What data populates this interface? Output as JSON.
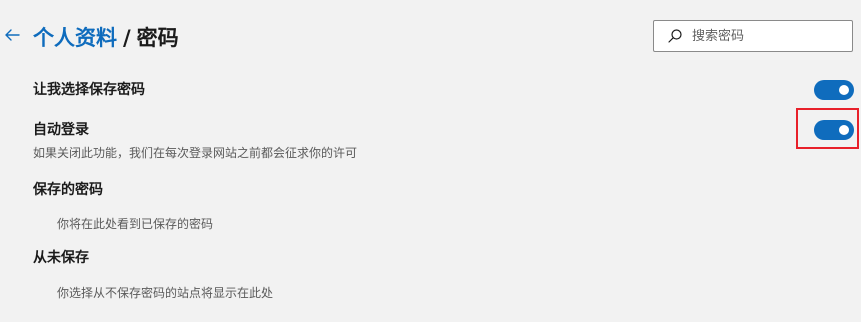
{
  "header": {
    "back_icon": "arrow-left-icon",
    "breadcrumb_parent": "个人资料",
    "breadcrumb_separator": "/",
    "breadcrumb_current": "密码"
  },
  "search": {
    "icon": "search-icon",
    "placeholder": "搜索密码",
    "value": ""
  },
  "settings": {
    "offer_to_save": {
      "label": "让我选择保存密码",
      "enabled": true
    },
    "auto_sign_in": {
      "label": "自动登录",
      "description": "如果关闭此功能，我们在每次登录网站之前都会征求你的许可",
      "enabled": true
    }
  },
  "saved_passwords": {
    "heading": "保存的密码",
    "empty_text": "你将在此处看到已保存的密码"
  },
  "never_saved": {
    "heading": "从未保存",
    "empty_text": "你选择从不保存密码的站点将显示在此处"
  },
  "colors": {
    "accent": "#0f6cbd",
    "highlight": "#e8202a",
    "background": "#f2f2f2"
  }
}
